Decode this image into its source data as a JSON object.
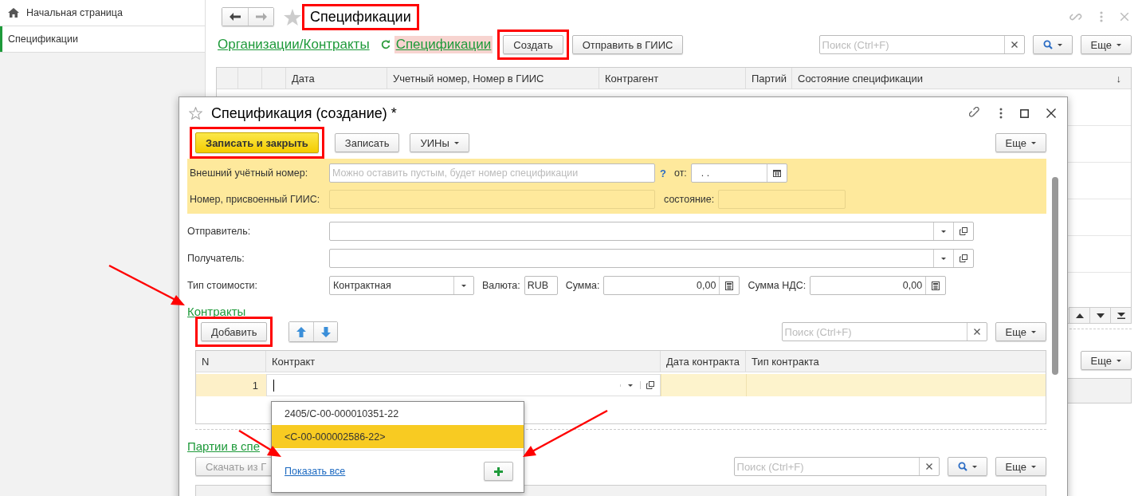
{
  "sidebar": {
    "items": [
      {
        "label": "Начальная страница",
        "kind": "home",
        "selected": false
      },
      {
        "label": "Спецификации",
        "kind": "page",
        "selected": true
      }
    ]
  },
  "list_window": {
    "title": "Спецификации",
    "title_highlighted": true,
    "breadcrumbs": [
      {
        "label": "Организации/Контракты",
        "current": false
      },
      {
        "label": "Спецификации",
        "current": true
      }
    ],
    "buttons": [
      {
        "label": "Создать",
        "highlighted": true
      },
      {
        "label": "Отправить в ГИИС",
        "highlighted": false
      }
    ],
    "search": {
      "placeholder": "Поиск (Ctrl+F)"
    },
    "more_button": "Еще",
    "columns": [
      "Дата",
      "Учетный номер, Номер в ГИИС",
      "Контрагент",
      "Партий",
      "Состояние спецификации"
    ],
    "sort_mark": "↓",
    "lower_more_button": "Еще"
  },
  "form": {
    "title": "Спецификация (создание) *",
    "toolbar": [
      {
        "label": "Записать и закрыть",
        "kind": "default",
        "highlighted": true
      },
      {
        "label": "Записать",
        "kind": "plain",
        "highlighted": false
      },
      {
        "label": "УИНы",
        "kind": "menu",
        "highlighted": false
      }
    ],
    "more_button": "Еще",
    "external_number": {
      "label": "Внешний учётный номер:",
      "placeholder": "Можно оставить пустым, будет номер спецификации",
      "help": "?",
      "date_label": "от:",
      "date_value": ".  ."
    },
    "giis_number": {
      "label": "Номер, присвоенный ГИИС:",
      "state_label": "состояние:"
    },
    "parties": [
      {
        "label": "Отправитель:"
      },
      {
        "label": "Получатель:"
      }
    ],
    "cost": {
      "label": "Тип стоимости:",
      "value": "Контрактная",
      "currency_label": "Валюта:",
      "currency": "RUB",
      "sum_label": "Сумма:",
      "sum": "0,00",
      "vat_label": "Сумма НДС:",
      "vat": "0,00"
    },
    "contracts": {
      "title": "Контракты",
      "arrow": true,
      "add_button": {
        "label": "Добавить",
        "highlighted": true
      },
      "search": {
        "placeholder": "Поиск (Ctrl+F)"
      },
      "more_button": "Еще",
      "columns": [
        "N",
        "Контракт",
        "Дата контракта",
        "Тип контракта"
      ],
      "rows": [
        {
          "n": "1",
          "editing": true
        }
      ],
      "dropdown": {
        "options": [
          {
            "label": "2405/С-00-000010351-22",
            "selected": false
          },
          {
            "label": "<С-00-000002586-22>",
            "selected": true
          }
        ],
        "show_all": "Показать все",
        "show_all_arrow": true,
        "add_arrow": true
      }
    },
    "batches": {
      "title": "Партии в спе",
      "download_button": {
        "label": "Скачать из Г",
        "disabled": true
      },
      "search": {
        "placeholder": "Поиск (Ctrl+F)"
      },
      "more_button": "Еще"
    }
  }
}
